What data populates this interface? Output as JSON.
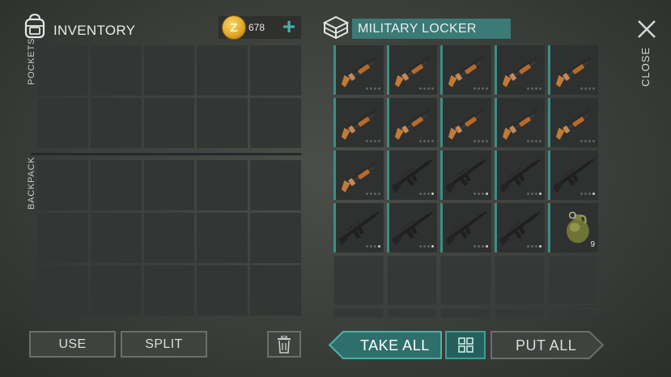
{
  "inventory": {
    "title": "INVENTORY",
    "coins": "678",
    "pockets_label": "POCKETS",
    "backpack_label": "BACKPACK",
    "pocket_slots": 10,
    "backpack_slots": 15
  },
  "container": {
    "title": "MILITARY LOCKER",
    "items": [
      {
        "icon": "shotgun-icon",
        "dots_filled": 0
      },
      {
        "icon": "shotgun-icon",
        "dots_filled": 0
      },
      {
        "icon": "shotgun-icon",
        "dots_filled": 0
      },
      {
        "icon": "shotgun-icon",
        "dots_filled": 0
      },
      {
        "icon": "shotgun-icon",
        "dots_filled": 0
      },
      {
        "icon": "shotgun-icon",
        "dots_filled": 0
      },
      {
        "icon": "shotgun-icon",
        "dots_filled": 0
      },
      {
        "icon": "shotgun-icon",
        "dots_filled": 0
      },
      {
        "icon": "shotgun-icon",
        "dots_filled": 0
      },
      {
        "icon": "shotgun-icon",
        "dots_filled": 0
      },
      {
        "icon": "shotgun-icon",
        "dots_filled": 0
      },
      {
        "icon": "assault-rifle-icon",
        "dots_filled": 1
      },
      {
        "icon": "assault-rifle-icon",
        "dots_filled": 1
      },
      {
        "icon": "assault-rifle-icon",
        "dots_filled": 1
      },
      {
        "icon": "assault-rifle-icon",
        "dots_filled": 1
      },
      {
        "icon": "assault-rifle-icon",
        "dots_filled": 1
      },
      {
        "icon": "assault-rifle-icon",
        "dots_filled": 1
      },
      {
        "icon": "assault-rifle-icon",
        "dots_filled": 1
      },
      {
        "icon": "assault-rifle-icon",
        "dots_filled": 1
      },
      {
        "icon": "grenade-icon",
        "quantity": "9"
      }
    ],
    "empty_slots": 10
  },
  "close_label": "CLOSE",
  "buttons": {
    "use": "USE",
    "split": "SPLIT",
    "take_all": "TAKE ALL",
    "put_all": "PUT ALL"
  },
  "colors": {
    "accent": "#3fb6a8",
    "title_bar": "#3b7a76",
    "take_all_bg": "#2f6f6b"
  }
}
